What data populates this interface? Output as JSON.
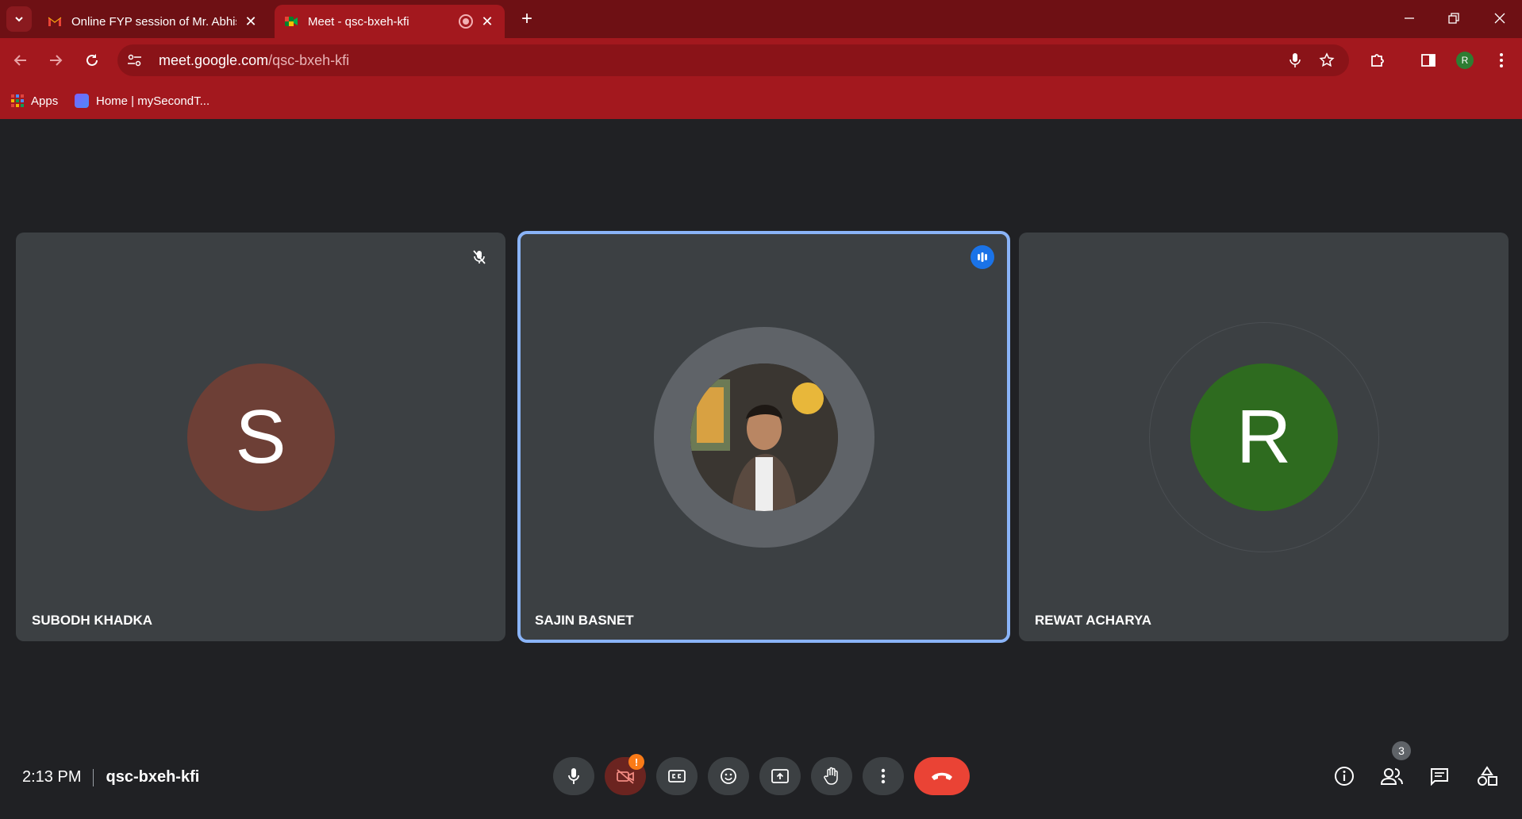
{
  "browser": {
    "tabs": [
      {
        "title": "Online FYP session of Mr. Abhis",
        "favicon": "gmail-icon",
        "active": false
      },
      {
        "title": "Meet - qsc-bxeh-kfi",
        "favicon": "meet-icon",
        "active": true
      }
    ],
    "url_host": "meet.google.com",
    "url_path": "/qsc-bxeh-kfi",
    "profile_initial": "R",
    "bookmarks": [
      {
        "label": "Apps",
        "icon": "apps-grid-icon"
      },
      {
        "label": "Home | mySecondT...",
        "icon": "site-favicon-icon"
      }
    ],
    "theme_color": "#a3181e"
  },
  "meeting": {
    "participants": [
      {
        "name": "SUBODH KHADKA",
        "initial": "S",
        "avatar_color": "#6d3f36",
        "muted": true,
        "speaking": false
      },
      {
        "name": "SAJIN BASNET",
        "initial": "",
        "avatar_color": "#5f6368",
        "muted": false,
        "speaking": true
      },
      {
        "name": "REWAT ACHARYA",
        "initial": "R",
        "avatar_color": "#2e6b1f",
        "muted": false,
        "speaking": false
      }
    ],
    "time": "2:13 PM",
    "code": "qsc-bxeh-kfi",
    "people_count": "3",
    "camera_alert": "!",
    "speaking_color": "#8ab4f8",
    "end_call_color": "#ea4335"
  }
}
